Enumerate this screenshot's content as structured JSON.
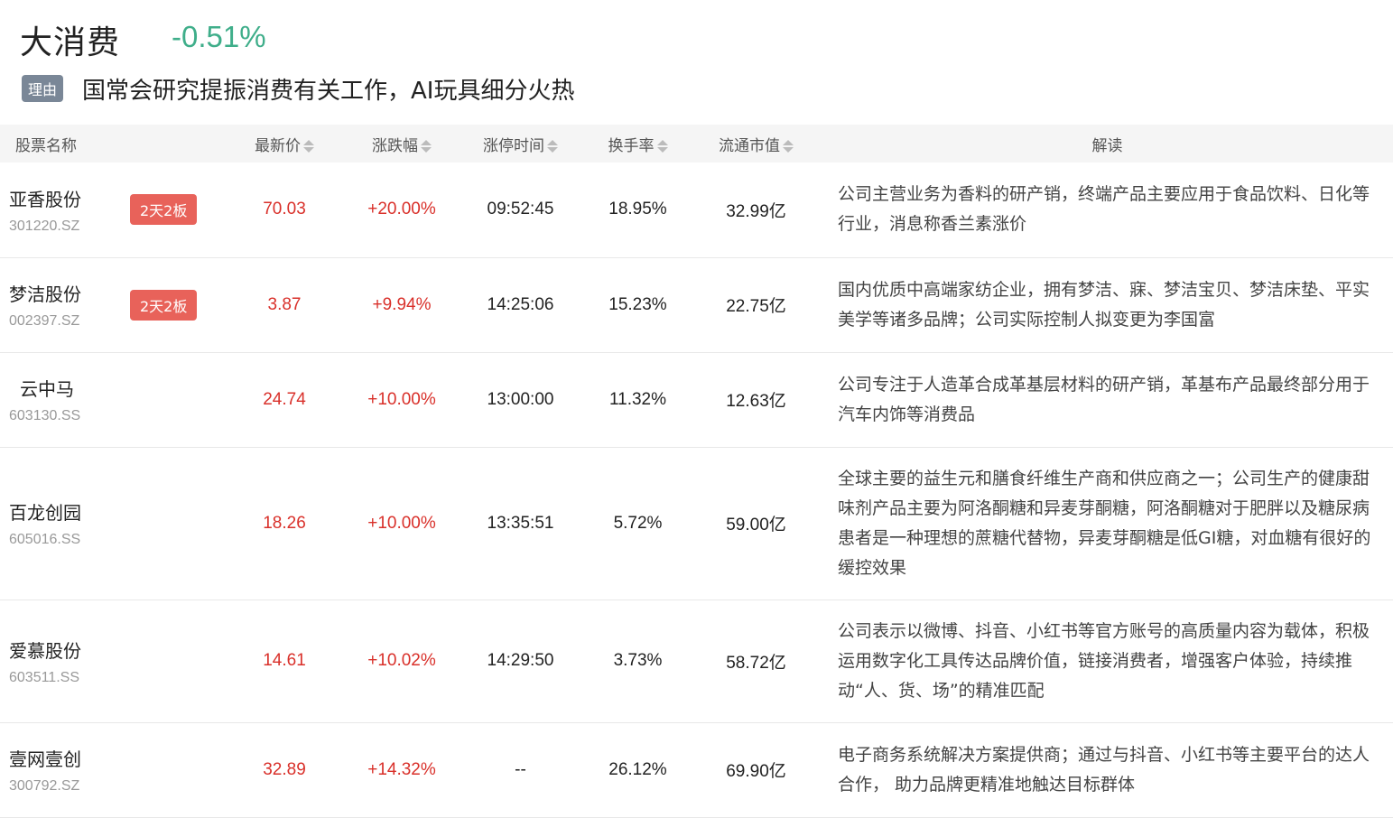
{
  "sector": {
    "name": "大消费",
    "change": "-0.51%"
  },
  "reason": {
    "tag": "理由",
    "text": "国常会研究提振消费有关工作，AI玩具细分火热"
  },
  "columns": [
    "股票名称",
    "最新价",
    "涨跌幅",
    "涨停时间",
    "换手率",
    "流通市值",
    "解读"
  ],
  "rows": [
    {
      "name": "亚香股份",
      "code": "301220.SZ",
      "badge": "2天2板",
      "price": "70.03",
      "pct": "+20.00%",
      "time": "09:52:45",
      "turnover": "18.95%",
      "mcap": "32.99亿",
      "desc": "公司主营业务为香料的研产销，终端产品主要应用于食品饮料、日化等行业，消息称香兰素涨价"
    },
    {
      "name": "梦洁股份",
      "code": "002397.SZ",
      "badge": "2天2板",
      "price": "3.87",
      "pct": "+9.94%",
      "time": "14:25:06",
      "turnover": "15.23%",
      "mcap": "22.75亿",
      "desc": "国内优质中高端家纺企业，拥有梦洁、寐、梦洁宝贝、梦洁床垫、平实美学等诸多品牌；公司实际控制人拟变更为李国富"
    },
    {
      "name": "云中马",
      "code": "603130.SS",
      "badge": "",
      "price": "24.74",
      "pct": "+10.00%",
      "time": "13:00:00",
      "turnover": "11.32%",
      "mcap": "12.63亿",
      "desc": "公司专注于人造革合成革基层材料的研产销，革基布产品最终部分用于汽车内饰等消费品"
    },
    {
      "name": "百龙创园",
      "code": "605016.SS",
      "badge": "",
      "price": "18.26",
      "pct": "+10.00%",
      "time": "13:35:51",
      "turnover": "5.72%",
      "mcap": "59.00亿",
      "desc": "全球主要的益生元和膳食纤维生产商和供应商之一；公司生产的健康甜味剂产品主要为阿洛酮糖和异麦芽酮糖，阿洛酮糖对于肥胖以及糖尿病患者是一种理想的蔗糖代替物，异麦芽酮糖是低GI糖，对血糖有很好的缓控效果"
    },
    {
      "name": "爱慕股份",
      "code": "603511.SS",
      "badge": "",
      "price": "14.61",
      "pct": "+10.02%",
      "time": "14:29:50",
      "turnover": "3.73%",
      "mcap": "58.72亿",
      "desc": "公司表示以微博、抖音、小红书等官方账号的高质量内容为载体，积极运用数字化工具传达品牌价值，链接消费者，增强客户体验，持续推动“人、货、场”的精准匹配"
    },
    {
      "name": "壹网壹创",
      "code": "300792.SZ",
      "badge": "",
      "price": "32.89",
      "pct": "+14.32%",
      "time": "--",
      "turnover": "26.12%",
      "mcap": "69.90亿",
      "desc": "电子商务系统解决方案提供商；通过与抖音、小红书等主要平台的达人合作， 助力品牌更精准地触达目标群体"
    }
  ]
}
